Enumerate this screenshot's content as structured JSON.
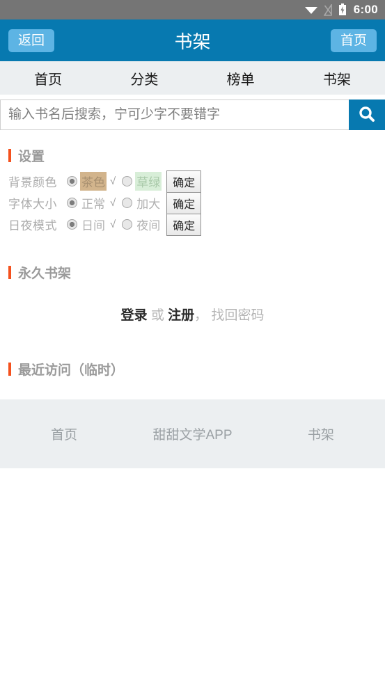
{
  "statusbar": {
    "time": "6:00",
    "icons": [
      "wifi-icon",
      "signal-off-icon",
      "battery-charging-icon"
    ]
  },
  "header": {
    "back_label": "返回",
    "title": "书架",
    "home_label": "首页",
    "bg_color": "#0779b0",
    "button_color": "#5db4e4"
  },
  "tabnav": {
    "tabs": [
      {
        "label": "首页"
      },
      {
        "label": "分类"
      },
      {
        "label": "榜单"
      },
      {
        "label": "书架"
      }
    ]
  },
  "search": {
    "value": "",
    "placeholder": "输入书名后搜索，宁可少字不要错字",
    "button_icon": "search-icon"
  },
  "settings": {
    "title": "设置",
    "accent_color": "#f4511e",
    "rows": [
      {
        "label": "背景颜色",
        "option1": "茶色",
        "option1_bg": "#d2b48c",
        "option1_selected": true,
        "check": "√",
        "option2": "草绿",
        "option2_bg": "#d8eed8",
        "option2_selected": false,
        "confirm": "确定"
      },
      {
        "label": "字体大小",
        "option1": "正常",
        "option1_selected": true,
        "check": "√",
        "option2": "加大",
        "option2_selected": false,
        "confirm": "确定"
      },
      {
        "label": "日夜模式",
        "option1": "日间",
        "option1_selected": true,
        "check": "√",
        "option2": "夜间",
        "option2_selected": false,
        "confirm": "确定"
      }
    ]
  },
  "shelf": {
    "title": "永久书架",
    "login": "登录",
    "or": "或",
    "register": "注册",
    "comma": "，",
    "forgot": "找回密码"
  },
  "recent": {
    "title": "最近访问（临时）"
  },
  "footer": {
    "links": [
      {
        "label": "首页"
      },
      {
        "label": "甜甜文学APP"
      },
      {
        "label": "书架"
      }
    ]
  }
}
